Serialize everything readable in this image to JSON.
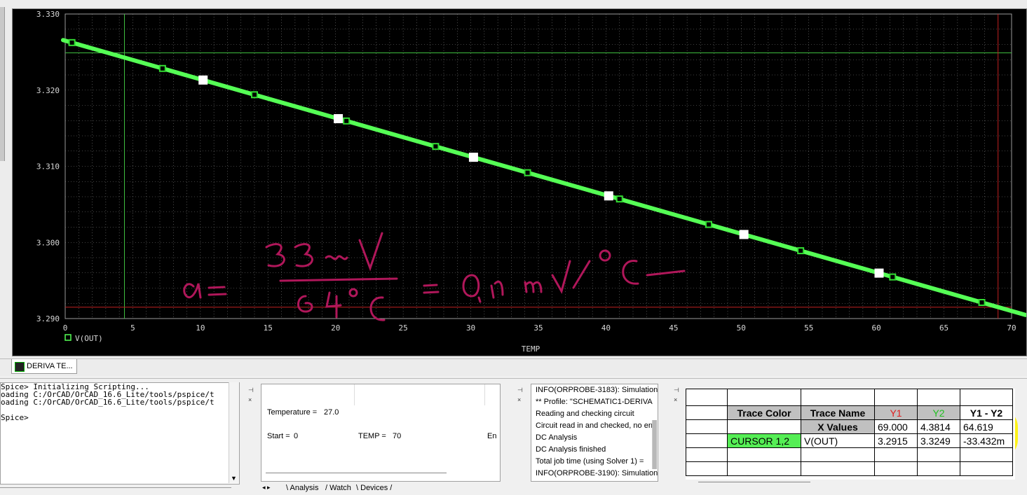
{
  "plot": {
    "y_axis_labels": [
      "3.330",
      "3.320",
      "3.310",
      "3.300",
      "3.290"
    ],
    "x_axis_labels": [
      "0",
      "5",
      "10",
      "15",
      "20",
      "25",
      "30",
      "35",
      "40",
      "45",
      "50",
      "55",
      "60",
      "65",
      "70"
    ],
    "x_axis_title": "TEMP",
    "legend_label": "V(OUT)",
    "annotation": "α = 33 mV / 64 °C = 0,51 mV/°C",
    "colors": {
      "trace": "#55ff55",
      "grid": "#7f7f7f",
      "cursor1": "#c02020",
      "cursor2": "#3fbf3f",
      "annotation": "#b0175a",
      "highlight": "#fff200"
    }
  },
  "chart_data": {
    "type": "line",
    "title": "",
    "xlabel": "TEMP",
    "ylabel": "",
    "xlim": [
      0,
      70
    ],
    "ylim": [
      3.29,
      3.33
    ],
    "grid": true,
    "series": [
      {
        "name": "V(OUT)",
        "x": [
          0,
          70
        ],
        "y": [
          3.3265,
          3.291
        ]
      }
    ],
    "markers_green_x": [
      0.5,
      7.2,
      14,
      20.8,
      27.4,
      34.2,
      41,
      47.6,
      54.4,
      61.2,
      67.8
    ],
    "markers_white_x": [
      10.2,
      20.2,
      30.2,
      40.2,
      50.2,
      60.2
    ],
    "cursors": [
      {
        "axis": "x",
        "value": 4.3814
      },
      {
        "axis": "y",
        "value": 3.3249
      },
      {
        "axis": "x",
        "value": 69.0
      },
      {
        "axis": "y",
        "value": 3.2915
      }
    ]
  },
  "doc_tab": {
    "label": "DERIVA TE..."
  },
  "console": {
    "lines": [
      "Spice> Initializing Scripting...",
      "oading C:/OrCAD/OrCAD_16.6_Lite/tools/pspice/t",
      "oading C:/OrCAD/OrCAD_16.6_Lite/tools/pspice/t",
      "",
      "Spice>"
    ]
  },
  "sim": {
    "temperature_label": "Temperature =",
    "temperature_value": "27.0",
    "start_label": "Start =",
    "start_value": "0",
    "temp_label": "TEMP =",
    "temp_value": "70",
    "end_label": "En",
    "tabs": [
      "Analysis",
      "Watch",
      "Devices"
    ]
  },
  "messages": [
    "INFO(ORPROBE-3183): Simulation",
    "** Profile: \"SCHEMATIC1-DERIVA",
    "Reading and checking circuit",
    "Circuit read in and checked, no err",
    "DC Analysis",
    "DC Analysis finished",
    "  Total job time (using Solver 1)  =",
    "INFO(ORPROBE-3190): Simulation"
  ],
  "cursor_table": {
    "headers": [
      "Trace Color",
      "Trace Name",
      "Y1",
      "Y2",
      "Y1 - Y2"
    ],
    "header_colors": {
      "Y1": "#e02020",
      "Y2": "#20c020"
    },
    "x_row": {
      "label": "X Values",
      "y1": "69.000",
      "y2": "4.3814",
      "diff": "64.619"
    },
    "trace_row": {
      "color_label": "CURSOR 1,2",
      "name": "V(OUT)",
      "y1": "3.2915",
      "y2": "3.3249",
      "diff": "-33.432m",
      "color": "#55ee55"
    }
  }
}
